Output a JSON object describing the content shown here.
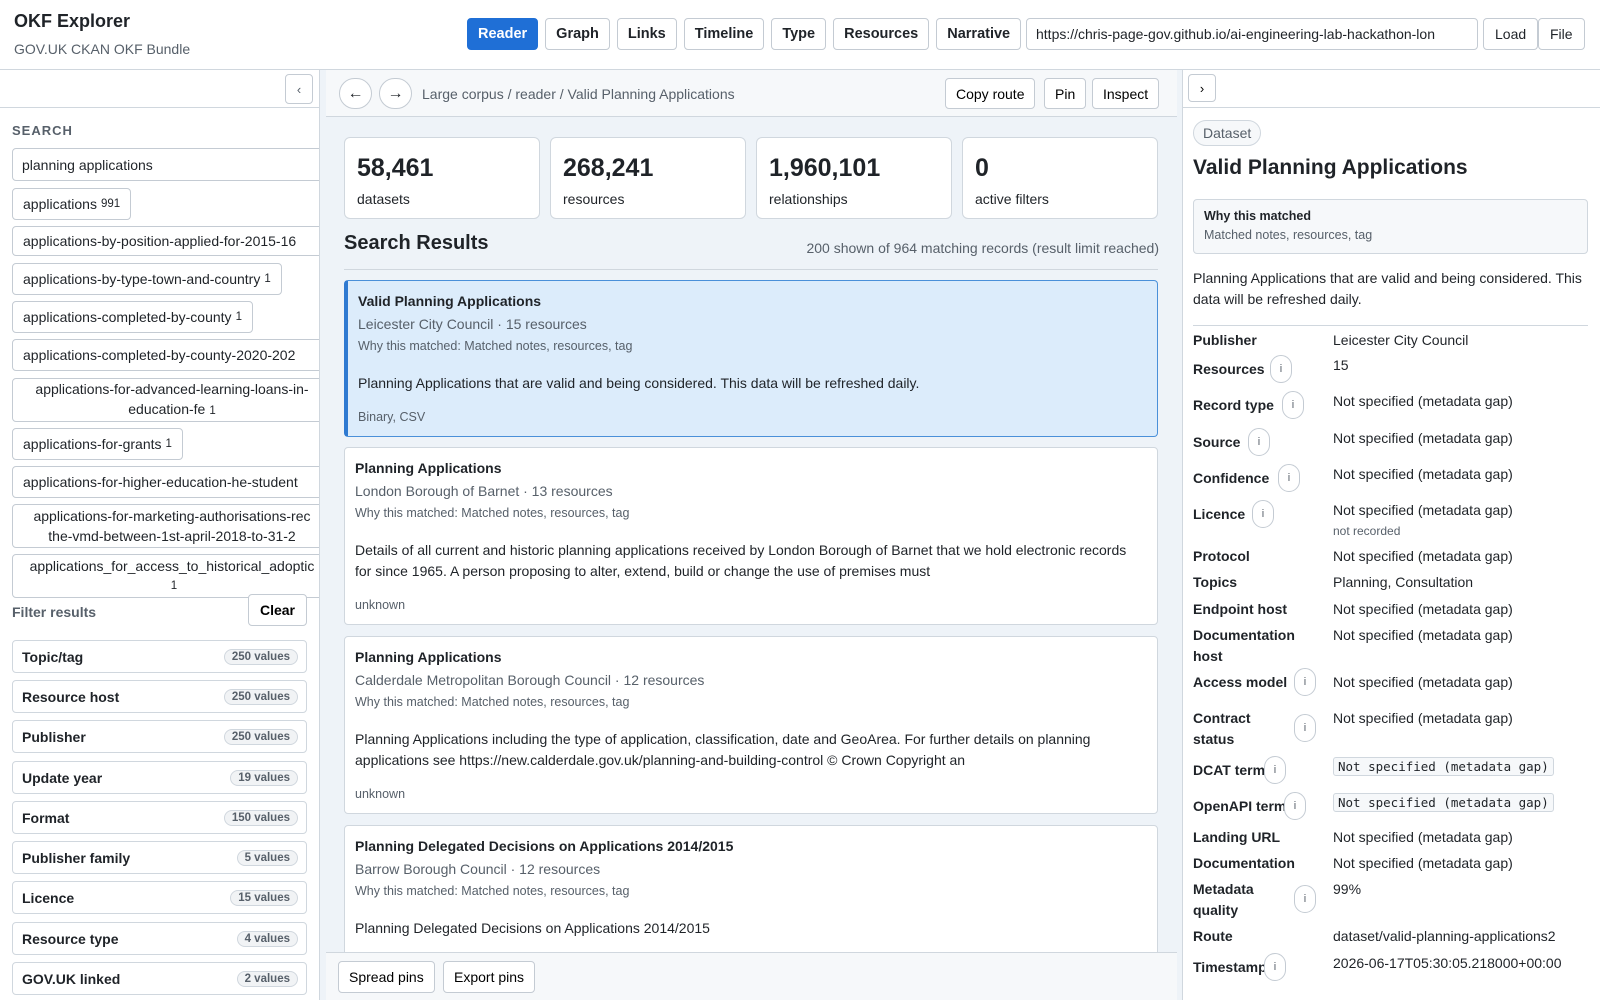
{
  "app": {
    "title": "OKF Explorer",
    "subtitle": "GOV.UK CKAN OKF Bundle"
  },
  "tabs": [
    {
      "label": "Reader",
      "active": true
    },
    {
      "label": "Graph"
    },
    {
      "label": "Links"
    },
    {
      "label": "Timeline"
    },
    {
      "label": "Type"
    },
    {
      "label": "Resources"
    },
    {
      "label": "Narrative"
    }
  ],
  "url": {
    "value": "https://chris-page-gov.github.io/ai-engineering-lab-hackathon-lon"
  },
  "topbar": {
    "load_label": "Load",
    "file_label": "File"
  },
  "left": {
    "collapse_icon": "‹",
    "search_heading": "SEARCH",
    "search_value": "planning applications",
    "suggestions": [
      {
        "text": "applications",
        "count": "991"
      },
      {
        "text": "applications-by-position-applied-for-2015-16",
        "count": ""
      },
      {
        "text": "applications-by-type-town-and-country",
        "count": "1"
      },
      {
        "text": "applications-completed-by-county",
        "count": "1"
      },
      {
        "text": "applications-completed-by-county-2020-202",
        "count": ""
      },
      {
        "text": "applications-for-advanced-learning-loans-in-education-fe",
        "count": "1"
      },
      {
        "text": "applications-for-grants",
        "count": "1"
      },
      {
        "text": "applications-for-higher-education-he-student",
        "count": ""
      },
      {
        "text": "applications-for-marketing-authorisations-rec the-vmd-between-1st-april-2018-to-31-2",
        "count": ""
      },
      {
        "text": "applications_for_access_to_historical_adoptic",
        "count": "1"
      }
    ],
    "filter_label": "Filter results",
    "clear_label": "Clear",
    "facets": [
      {
        "label": "Topic/tag",
        "count": "250 values"
      },
      {
        "label": "Resource host",
        "count": "250 values"
      },
      {
        "label": "Publisher",
        "count": "250 values"
      },
      {
        "label": "Update year",
        "count": "19 values"
      },
      {
        "label": "Format",
        "count": "150 values"
      },
      {
        "label": "Publisher family",
        "count": "5 values"
      },
      {
        "label": "Licence",
        "count": "15 values"
      },
      {
        "label": "Resource type",
        "count": "4 values"
      },
      {
        "label": "GOV.UK linked",
        "count": "2 values"
      }
    ]
  },
  "center": {
    "back_icon": "←",
    "forward_icon": "→",
    "breadcrumb": "Large corpus / reader / Valid Planning Applications",
    "copy_route_label": "Copy route",
    "pin_label": "Pin",
    "inspect_label": "Inspect",
    "stats": [
      {
        "value": "58,461",
        "label": "datasets"
      },
      {
        "value": "268,241",
        "label": "resources"
      },
      {
        "value": "1,960,101",
        "label": "relationships"
      },
      {
        "value": "0",
        "label": "active filters"
      }
    ],
    "results_title": "Search Results",
    "results_summary": "200 shown of 964 matching records (result limit reached)",
    "results": [
      {
        "title": "Valid Planning Applications",
        "meta": "Leicester City Council · 15 resources",
        "why": "Why this matched: Matched notes, resources, tag",
        "desc": "Planning Applications that are valid and being considered. This data will be refreshed daily.",
        "formats": "Binary, CSV"
      },
      {
        "title": "Planning Applications",
        "meta": "London Borough of Barnet · 13 resources",
        "why": "Why this matched: Matched notes, resources, tag",
        "desc": "Details of all current and historic planning applications received by London Borough of Barnet that we hold electronic records for since 1965. A person proposing to alter, extend, build or change the use of premises must",
        "formats": "unknown"
      },
      {
        "title": "Planning Applications",
        "meta": "Calderdale Metropolitan Borough Council · 12 resources",
        "why": "Why this matched: Matched notes, resources, tag",
        "desc": "Planning Applications including the type of application, classification, date and GeoArea. For further details on planning applications see https://new.calderdale.gov.uk/planning-and-building-control © Crown Copyright an",
        "formats": "unknown"
      },
      {
        "title": "Planning Delegated Decisions on Applications 2014/2015",
        "meta": "Barrow Borough Council · 12 resources",
        "why": "Why this matched: Matched notes, resources, tag",
        "desc": "Planning Delegated Decisions on Applications 2014/2015",
        "formats": ""
      }
    ],
    "spread_pins_label": "Spread pins",
    "export_pins_label": "Export pins"
  },
  "right": {
    "expand_icon": "›",
    "type_badge": "Dataset",
    "title": "Valid Planning Applications",
    "why_heading": "Why this matched",
    "why_text": "Matched notes, resources, tag",
    "description": "Planning Applications that are valid and being considered. This data will be refreshed daily.",
    "info_icon": "i",
    "props": [
      {
        "label": "Publisher",
        "value": "Leicester City Council"
      },
      {
        "label": "Resources",
        "value": "15"
      },
      {
        "label": "Record type",
        "value": "Not specified (metadata gap)"
      },
      {
        "label": "Source",
        "value": "Not specified (metadata gap)"
      },
      {
        "label": "Confidence",
        "value": "Not specified (metadata gap)"
      },
      {
        "label": "Licence",
        "value": "Not specified (metadata gap)",
        "sub": "not recorded"
      },
      {
        "label": "Protocol",
        "value": "Not specified (metadata gap)"
      },
      {
        "label": "Topics",
        "value": "Planning, Consultation"
      },
      {
        "label": "Endpoint host",
        "value": "Not specified (metadata gap)"
      },
      {
        "label": "Documentation host",
        "value": "Not specified (metadata gap)"
      },
      {
        "label": "Access model",
        "value": "Not specified (metadata gap)"
      },
      {
        "label": "Contract status",
        "value": "Not specified (metadata gap)"
      },
      {
        "label": "DCAT term",
        "value": "Not specified (metadata gap)"
      },
      {
        "label": "OpenAPI term",
        "value": "Not specified (metadata gap)"
      },
      {
        "label": "Landing URL",
        "value": "Not specified (metadata gap)"
      },
      {
        "label": "Documentation",
        "value": "Not specified (metadata gap)"
      },
      {
        "label": "Metadata quality",
        "value": "99%"
      },
      {
        "label": "Route",
        "value": "dataset/valid-planning-applications2"
      },
      {
        "label": "Timestamp",
        "value": "2026-06-17T05:30:05.218000+00:00"
      }
    ]
  },
  "colors": {
    "accent": "#1f6fd6",
    "selected_card": "#dcecfb",
    "selected_border": "#2f7ad1"
  }
}
